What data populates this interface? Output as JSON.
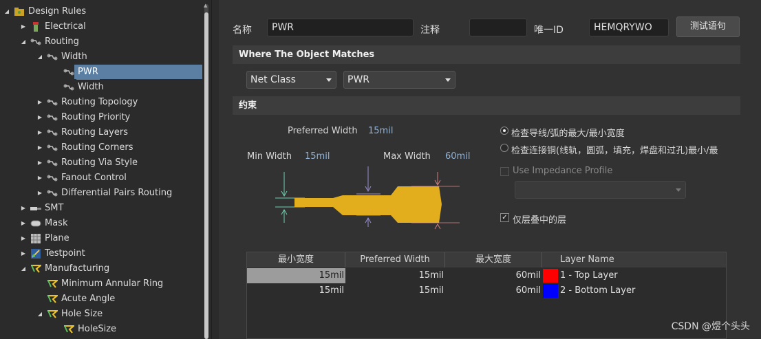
{
  "tree": {
    "items": [
      {
        "label": "Design Rules",
        "icon": "design-rules-icon",
        "expanded": true
      },
      {
        "label": "Electrical",
        "icon": "electrical-icon",
        "expanded": false
      },
      {
        "label": "Routing",
        "icon": "routing-icon",
        "expanded": true
      },
      {
        "label": "Width",
        "icon": "width-icon",
        "expanded": true
      },
      {
        "label": "PWR",
        "icon": "rule-icon",
        "selected": true
      },
      {
        "label": "Width",
        "icon": "rule-icon"
      },
      {
        "label": "Routing Topology",
        "icon": "routing-icon",
        "expanded": false
      },
      {
        "label": "Routing Priority",
        "icon": "routing-icon",
        "expanded": false
      },
      {
        "label": "Routing Layers",
        "icon": "routing-icon",
        "expanded": false
      },
      {
        "label": "Routing Corners",
        "icon": "routing-icon",
        "expanded": false
      },
      {
        "label": "Routing Via Style",
        "icon": "routing-icon",
        "expanded": false
      },
      {
        "label": "Fanout Control",
        "icon": "routing-icon",
        "expanded": false
      },
      {
        "label": "Differential Pairs Routing",
        "icon": "routing-icon",
        "expanded": false
      },
      {
        "label": "SMT",
        "icon": "smt-icon",
        "expanded": false
      },
      {
        "label": "Mask",
        "icon": "mask-icon",
        "expanded": false
      },
      {
        "label": "Plane",
        "icon": "plane-icon",
        "expanded": false
      },
      {
        "label": "Testpoint",
        "icon": "testpoint-icon",
        "expanded": false
      },
      {
        "label": "Manufacturing",
        "icon": "manufacturing-icon",
        "expanded": true
      },
      {
        "label": "Minimum Annular Ring",
        "icon": "manufacturing-icon"
      },
      {
        "label": "Acute Angle",
        "icon": "manufacturing-icon"
      },
      {
        "label": "Hole Size",
        "icon": "manufacturing-icon",
        "expanded": true
      },
      {
        "label": "HoleSize",
        "icon": "manufacturing-icon"
      }
    ]
  },
  "header": {
    "name_label": "名称",
    "name_value": "PWR",
    "comment_label": "注释",
    "comment_value": "",
    "uid_label": "唯一ID",
    "uid_value": "HEMQRYWO",
    "test_button": "测试语句"
  },
  "where": {
    "title": "Where The Object Matches",
    "scope_type": "Net Class",
    "scope_value": "PWR"
  },
  "constraints": {
    "title": "约束",
    "preferred_width_label": "Preferred Width",
    "preferred_width_value": "15mil",
    "min_width_label": "Min Width",
    "min_width_value": "15mil",
    "max_width_label": "Max Width",
    "max_width_value": "60mil",
    "radio_1": "检查导线/弧的最大/最小宽度",
    "radio_2": "检查连接铜(线轨，圆弧，填充，焊盘和过孔)最小/最",
    "radio_selected": 1,
    "impedance_label": "Use Impedance Profile",
    "impedance_enabled": false,
    "stack_only_label": "仅层叠中的层",
    "stack_only_checked": true
  },
  "table": {
    "headers": [
      "最小宽度",
      "Preferred Width",
      "最大宽度",
      "Layer Name"
    ],
    "rows": [
      {
        "min": "15mil",
        "pref": "15mil",
        "max": "60mil",
        "color": "#ff0000",
        "layer": "1 - Top Layer"
      },
      {
        "min": "15mil",
        "pref": "15mil",
        "max": "60mil",
        "color": "#0000ff",
        "layer": "2 - Bottom Layer"
      }
    ]
  },
  "watermark": "CSDN @煜个头头",
  "colors": {
    "track": "#e2ae1e",
    "selection": "#5b7fa3"
  }
}
